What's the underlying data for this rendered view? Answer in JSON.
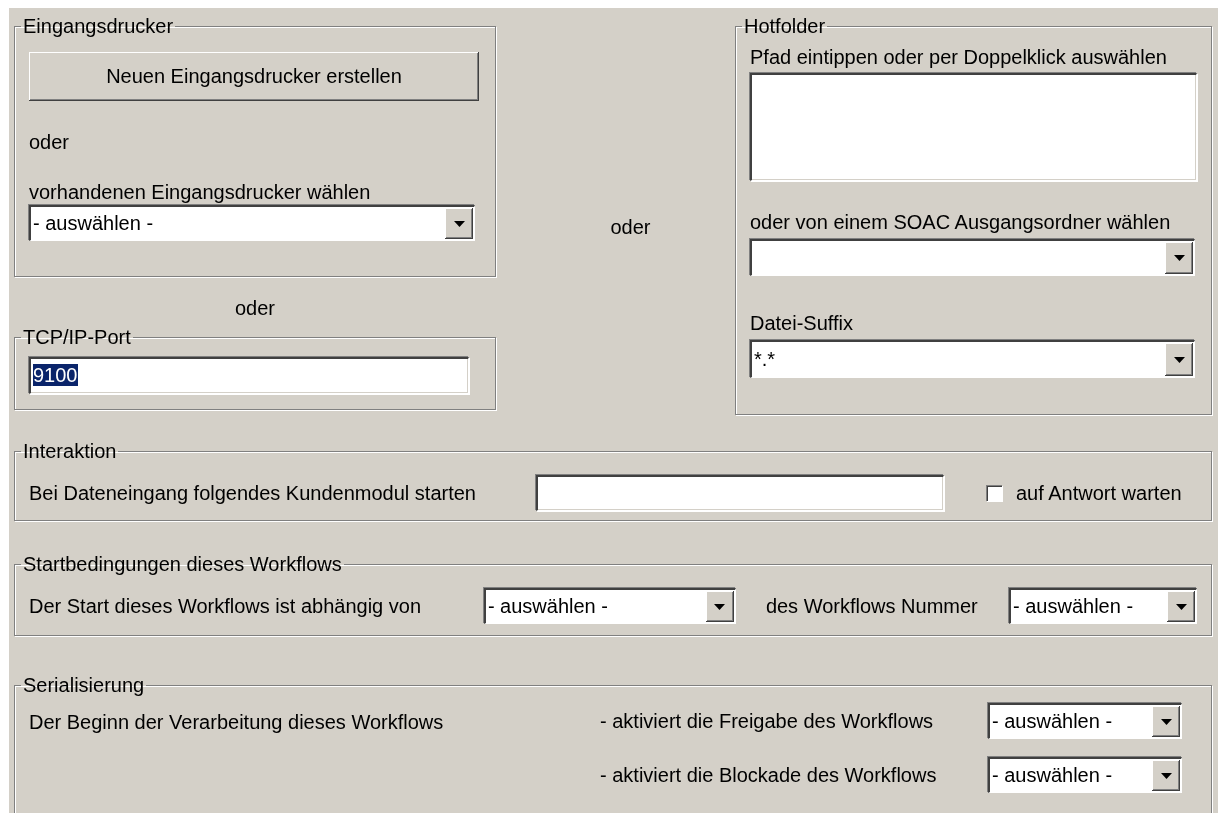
{
  "input_printer": {
    "title": "Eingangsdrucker",
    "create_button": "Neuen Eingangsdrucker erstellen",
    "or_label": "oder",
    "select_label": "vorhandenen Eingangsdrucker wählen",
    "select_value": "- auswählen -"
  },
  "or_between_groups": "oder",
  "tcp_port": {
    "title": "TCP/IP-Port",
    "value": "9100",
    "value_selected": true
  },
  "or_middle": "oder",
  "hotfolder": {
    "title": "Hotfolder",
    "path_label": "Pfad eintippen oder per Doppelklick auswählen",
    "folder_label": "oder von einem SOAC Ausgangsordner wählen",
    "suffix_label": "Datei-Suffix",
    "suffix_value": "*.*"
  },
  "interaction": {
    "title": "Interaktion",
    "module_label": "Bei Dateneingang folgendes Kundenmodul starten",
    "wait_checkbox": {
      "label": "auf Antwort warten",
      "checked": false
    }
  },
  "start_conditions": {
    "title": "Startbedingungen dieses Workflows",
    "depends_label": "Der Start dieses Workflows ist abhängig von",
    "depends_value": "- auswählen -",
    "number_label": "des Workflows Nummer",
    "number_value": "- auswählen -"
  },
  "serialization": {
    "title": "Serialisierung",
    "label": "Der Beginn der Verarbeitung dieses Workflows",
    "rows": [
      {
        "label": "- aktiviert die Freigabe des Workflows",
        "value": "- auswählen -"
      },
      {
        "label": "- aktiviert die Blockade des Workflows",
        "value": "- auswählen -"
      }
    ]
  }
}
